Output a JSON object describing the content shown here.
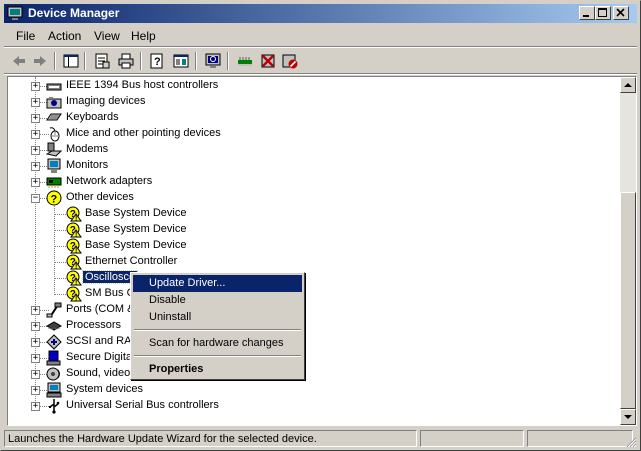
{
  "window": {
    "title": "Device Manager"
  },
  "menu": [
    "File",
    "Action",
    "View",
    "Help"
  ],
  "toolbar": {
    "buttons": [
      "back-icon",
      "forward-icon",
      "show-hide-tree-icon",
      "properties-icon",
      "print-icon",
      "help-icon",
      "console-tree-icon",
      "scan-hardware-icon",
      "update-driver-icon",
      "disable-device-icon",
      "uninstall-device-icon"
    ]
  },
  "tree": {
    "categories_top": [
      {
        "label": "IEEE 1394 Bus host controllers",
        "icon": "ieee1394-icon"
      },
      {
        "label": "Imaging devices",
        "icon": "imaging-icon"
      },
      {
        "label": "Keyboards",
        "icon": "keyboard-icon"
      },
      {
        "label": "Mice and other pointing devices",
        "icon": "mouse-icon"
      },
      {
        "label": "Modems",
        "icon": "modem-icon"
      },
      {
        "label": "Monitors",
        "icon": "monitor-icon"
      },
      {
        "label": "Network adapters",
        "icon": "network-adapter-icon"
      }
    ],
    "other_devices": {
      "label": "Other devices",
      "children": [
        "Base System Device",
        "Base System Device",
        "Base System Device",
        "Ethernet Controller",
        "Oscillosco",
        "SM Bus C"
      ]
    },
    "categories_bottom": [
      {
        "label": "Ports (COM &",
        "icon": "port-icon"
      },
      {
        "label": "Processors",
        "icon": "processor-icon"
      },
      {
        "label": "SCSI and RAI",
        "icon": "scsi-icon"
      },
      {
        "label": "Secure Digita",
        "icon": "secure-digital-icon"
      },
      {
        "label": "Sound, video",
        "icon": "sound-icon"
      },
      {
        "label": "System devices",
        "icon": "system-devices-icon"
      },
      {
        "label": "Universal Serial Bus controllers",
        "icon": "usb-icon"
      }
    ]
  },
  "context_menu": {
    "items": [
      "Update Driver...",
      "Disable",
      "Uninstall",
      "Scan for hardware changes",
      "Properties"
    ]
  },
  "status": {
    "text": "Launches the Hardware Update Wizard for the selected device."
  },
  "colors": {
    "selection": "#0a246a",
    "titlebar_start": "#0a246a",
    "titlebar_end": "#a6caf0",
    "face": "#d4d0c8"
  }
}
